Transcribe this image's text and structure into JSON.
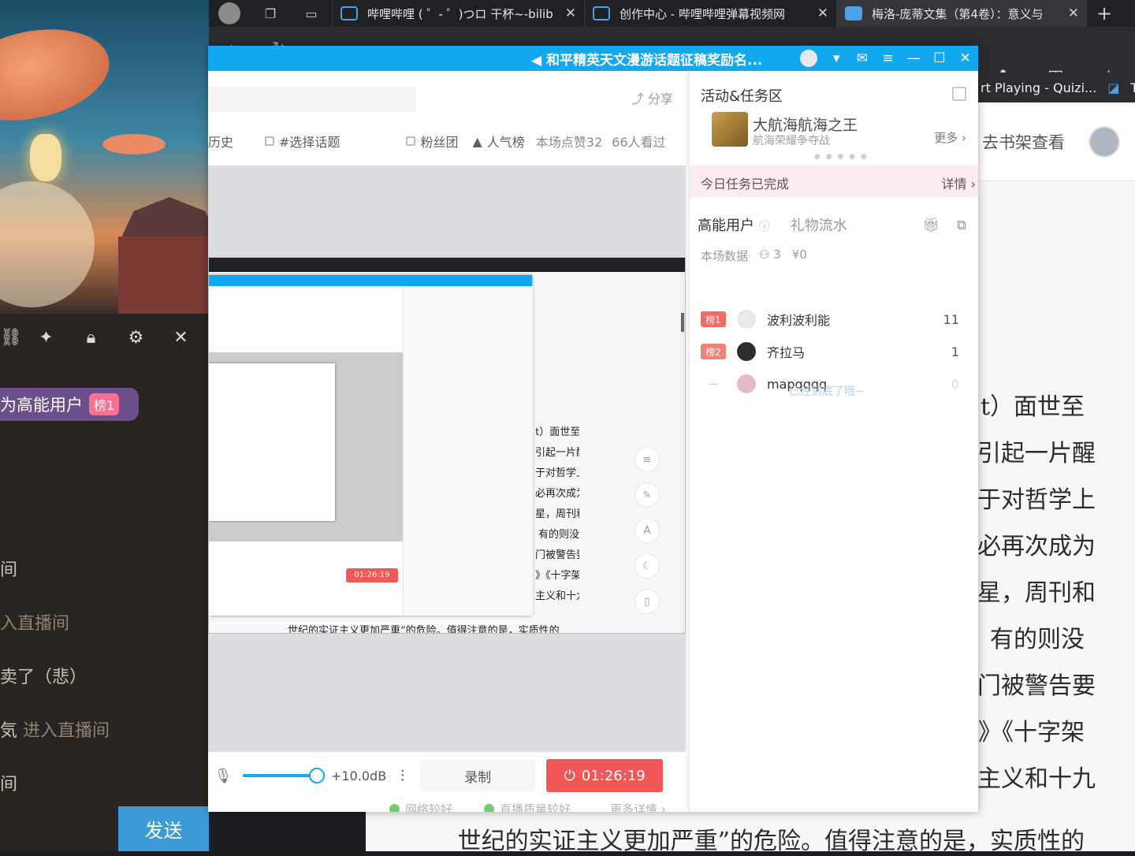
{
  "left_panel": {
    "toolbar_icons": [
      "link-icon",
      "puzzle-icon",
      "lock-icon",
      "gear-icon",
      "close-icon"
    ],
    "high_energy_badge": {
      "text": "为高能用户",
      "rank": "榜1"
    },
    "chat_lines": [
      {
        "main": "间",
        "dim": ""
      },
      {
        "main": "",
        "dim": "入直播间"
      },
      {
        "main": "卖了（悲）",
        "dim": ""
      },
      {
        "main": "気",
        "dim": " 进入直播间"
      },
      {
        "main": "间",
        "dim": ""
      }
    ],
    "send_label": "发送"
  },
  "browser": {
    "tabs": [
      {
        "title": "哔哩哔哩 ( ゜- ゜)つロ 干杯~-bilib",
        "close": "✕"
      },
      {
        "title": "创作中心 - 哔哩哔哩弹幕视频网",
        "close": "✕"
      },
      {
        "title": "梅洛-庞蒂文集（第4卷）：意义与",
        "close": "✕"
      }
    ],
    "new_tab": "+",
    "bookmarks": [
      "rt Playing - Quizi...",
      "Tu"
    ]
  },
  "novel": {
    "shelf_link": "去书架查看",
    "lines": [
      "t）面世至",
      "引起一片醒",
      "于对哲学上",
      "必再次成为",
      "星，周刊和",
      "有的则没",
      "门被警告要",
      "》《十字架",
      "主义和十九"
    ],
    "bottom_line": "世纪的实证主义更加严重”的危险。值得注意的是，实质性的"
  },
  "live_window": {
    "title": "和平精英天文漫游话题征稿奖励名...",
    "title_speaker": "◀",
    "controls": [
      "▾",
      "✉",
      "≡",
      "—",
      "☐",
      "✕"
    ],
    "share": "分享",
    "toolbar": {
      "history": "历史",
      "topic": "#选择话题",
      "fans": "粉丝团",
      "popularity": "人气榜",
      "likes": "本场点赞32",
      "viewers": "66人看过"
    },
    "preview": {
      "timer": "01:26:19",
      "lines": [
        "t）面世至",
        "引起一片醒",
        "于对哲学上",
        "必再次成为",
        "星，周刊和",
        "有的则没",
        "门被警告要",
        "》《十字架",
        "主义和十九"
      ],
      "bottom_line": "世纪的实证主义更加严重”的危险。值得注意的是，实质性的",
      "tools": [
        "≡",
        "✎",
        "A",
        "☾",
        "▯"
      ]
    },
    "audio": {
      "gain": "+10.0dB",
      "level": 0.75
    },
    "record_label": "录制",
    "live_timer": "01:26:19",
    "status": {
      "network": "网络较好",
      "quality": "直播质量较好",
      "more": "更多详情 ›"
    },
    "side": {
      "activity_title": "活动&任务区",
      "activity_name": "大航海航海之王",
      "activity_sub": "航海荣耀争夺战",
      "activity_more": "更多 ›",
      "task_done": "今日任务已完成",
      "task_detail": "详情 ›",
      "hu_tab": "高能用户",
      "gift_tab": "礼物流水",
      "stats_label": "本场数据",
      "stats_users": "3",
      "stats_money": "¥0",
      "users": [
        {
          "rank": "榜1",
          "name": "波利波利能",
          "count": "11"
        },
        {
          "rank": "榜2",
          "name": "齐拉马",
          "count": "1"
        },
        {
          "rank": "—",
          "name": "mapqqqq",
          "count": "0"
        }
      ],
      "end_text": "已经到底了哦~"
    }
  }
}
